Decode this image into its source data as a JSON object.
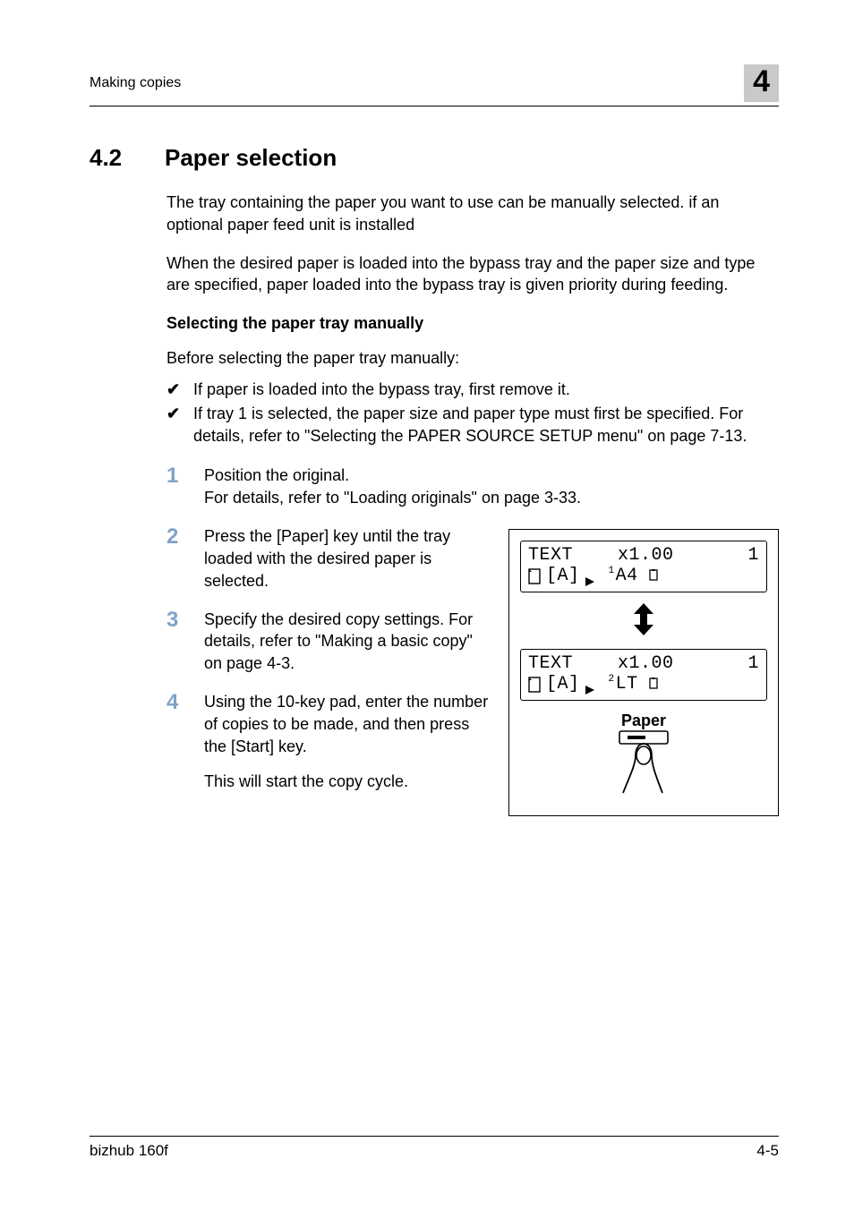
{
  "runningHead": {
    "title": "Making copies",
    "chapter": "4"
  },
  "section": {
    "number": "4.2",
    "title": "Paper selection"
  },
  "intro1": "The tray containing the paper you want to use can be manually selected. if an optional paper feed unit is installed",
  "intro2": "When the desired paper is loaded into the bypass tray and the paper size and type are specified, paper loaded into the bypass tray is given priority during feeding.",
  "subhead": "Selecting the paper tray manually",
  "beforeLine": "Before selecting the paper tray manually:",
  "checks": [
    "If paper is loaded into the bypass tray, first remove it.",
    "If tray 1 is selected, the paper size and paper type must first be specified. For details, refer to \"Selecting the PAPER SOURCE SETUP menu\" on page 7-13."
  ],
  "steps": [
    {
      "n": "1",
      "t": "Position the original.\nFor details, refer to \"Loading originals\" on page 3-33."
    },
    {
      "n": "2",
      "t": "Press the [Paper] key until the tray loaded with the desired paper is selected."
    },
    {
      "n": "3",
      "t": "Specify the desired copy settings. For details, refer to \"Making a basic copy\" on page 4-3."
    },
    {
      "n": "4",
      "t": "Using the 10-key pad, enter the number of copies to be made, and then press the [Start] key."
    }
  ],
  "step4tail": "This will start the copy cycle.",
  "figure": {
    "lcd1": {
      "mode": "TEXT",
      "zoom": "x1.00",
      "count": "1",
      "trayIdx": "1",
      "size": "A4"
    },
    "lcd2": {
      "mode": "TEXT",
      "zoom": "x1.00",
      "count": "1",
      "trayIdx": "2",
      "size": "LT"
    },
    "keyLabel": "Paper"
  },
  "footer": {
    "product": "bizhub 160f",
    "page": "4-5"
  }
}
